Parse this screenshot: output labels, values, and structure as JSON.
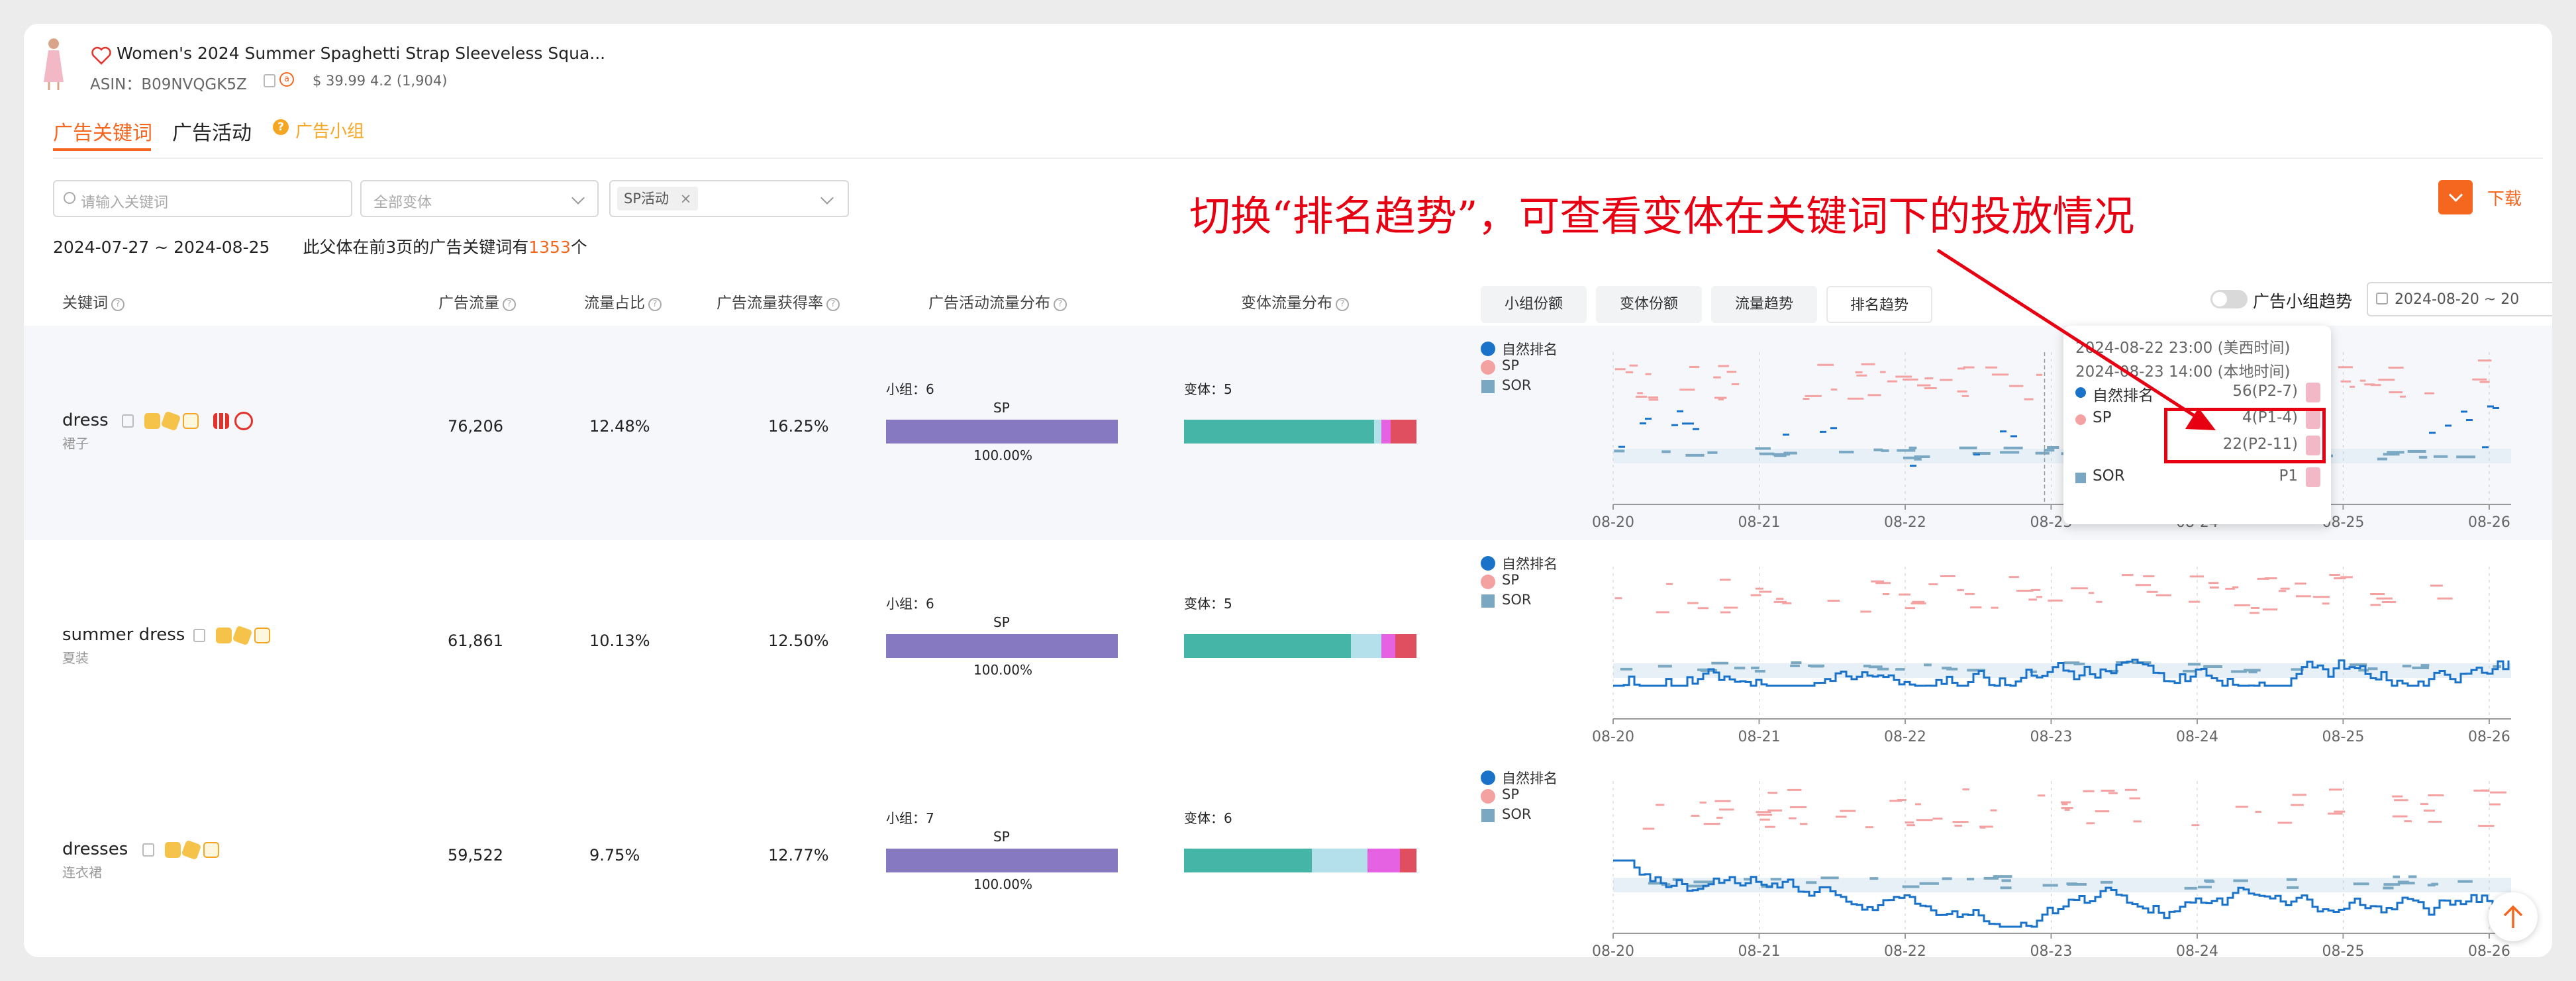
{
  "product": {
    "title": "Women's 2024 Summer Spaghetti Strap Sleeveless Squa...",
    "asin_label": "ASIN：",
    "asin": "B09NVQGK5Z",
    "price_rating": "$ 39.99 4.2 (1,904)"
  },
  "tabs": [
    "广告关键词",
    "广告活动",
    "广告小组"
  ],
  "filters": {
    "keyword_placeholder": "请输入关键词",
    "variant_label": "全部变体",
    "campaign_tag": "SP活动"
  },
  "summary": {
    "date_range": "2024-07-27 ~ 2024-08-25",
    "text_before": "此父体在前3页的广告关键词有",
    "count": "1353",
    "text_after": "个"
  },
  "download_label": "下载",
  "columns": [
    "关键词",
    "广告流量",
    "流量占比",
    "广告流量获得率",
    "广告活动流量分布",
    "变体流量分布"
  ],
  "chart_tabs": [
    "小组份额",
    "变体份额",
    "流量趋势",
    "排名趋势"
  ],
  "group_trend_label": "广告小组趋势",
  "date_picker": "2024-08-20  ~  20",
  "annotation": "切换“排名趋势”，可查看变体在关键词下的投放情况",
  "legend": {
    "organic": "自然排名",
    "sp": "SP",
    "sor": "SOR"
  },
  "x_ticks": [
    "08-20",
    "08-21",
    "08-22",
    "08-23",
    "08-24",
    "08-25",
    "08-26"
  ],
  "rows": [
    {
      "keyword": "dress",
      "cn": "裙子",
      "traffic": "76,206",
      "share": "12.48%",
      "rate": "16.25%",
      "group_label": "小组：",
      "groups": "6",
      "campaign": "SP",
      "campaign_pct": "100.00%",
      "variant_label": "变体：",
      "variants": "5",
      "variant_dist": [
        0.82,
        0.03,
        0.04,
        0.11
      ]
    },
    {
      "keyword": "summer dress",
      "cn": "夏装",
      "traffic": "61,861",
      "share": "10.13%",
      "rate": "12.50%",
      "group_label": "小组：",
      "groups": "6",
      "campaign": "SP",
      "campaign_pct": "100.00%",
      "variant_label": "变体：",
      "variants": "5",
      "variant_dist": [
        0.72,
        0.13,
        0.06,
        0.09
      ]
    },
    {
      "keyword": "dresses",
      "cn": "连衣裙",
      "traffic": "59,522",
      "share": "9.75%",
      "rate": "12.77%",
      "group_label": "小组：",
      "groups": "7",
      "campaign": "SP",
      "campaign_pct": "100.00%",
      "variant_label": "变体：",
      "variants": "6",
      "variant_dist": [
        0.55,
        0.24,
        0.14,
        0.07
      ]
    }
  ],
  "tooltip": {
    "time_us": "2024-08-22 23:00 (美西时间)",
    "time_local": "2024-08-23 14:00 (本地时间)",
    "organic_label": "自然排名",
    "organic_value": "56(P2-7)",
    "sp_label": "SP",
    "sp_values": [
      "4(P1-4)",
      "22(P2-11)"
    ],
    "sor_label": "SOR",
    "sor_value": "P1"
  },
  "colors": {
    "accent": "#f5661f",
    "annotation": "#e60012",
    "campaign_bar": "#8679c2",
    "organic": "#1a73c9",
    "sp": "#f4a1a1",
    "sor": "#7aa8c3",
    "variant": [
      "#45b5a7",
      "#b3e0ea",
      "#e563e3",
      "#e04f5f"
    ]
  }
}
